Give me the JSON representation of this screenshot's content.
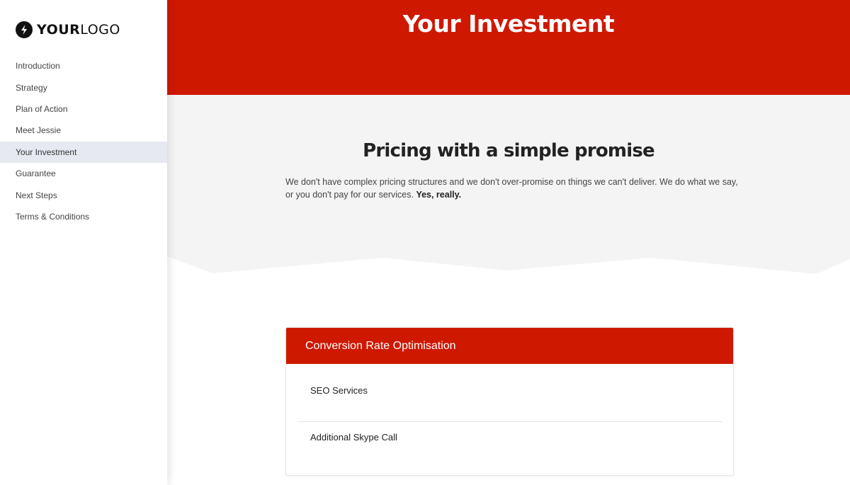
{
  "logo": {
    "icon": "lightning-bolt-icon",
    "text_bold": "YOUR",
    "text_light": "LOGO"
  },
  "sidebar": {
    "items": [
      {
        "label": "Introduction",
        "active": false
      },
      {
        "label": "Strategy",
        "active": false
      },
      {
        "label": "Plan of Action",
        "active": false
      },
      {
        "label": "Meet Jessie",
        "active": false
      },
      {
        "label": "Your Investment",
        "active": true
      },
      {
        "label": "Guarantee",
        "active": false
      },
      {
        "label": "Next Steps",
        "active": false
      },
      {
        "label": "Terms & Conditions",
        "active": false
      }
    ]
  },
  "hero": {
    "title": "Your Investment"
  },
  "intro": {
    "title": "Pricing with a simple promise",
    "text": "We don't have complex pricing structures and we don't over-promise on things we can't deliver. We do what we say, or you don't pay for our services.",
    "emphasis": "Yes, really."
  },
  "pricing_card": {
    "title": "Conversion Rate Optimisation",
    "items": [
      {
        "label": "SEO Services"
      },
      {
        "label": "Additional Skype Call"
      }
    ]
  },
  "colors": {
    "brand_red": "#cf1800",
    "section_gray": "#f4f4f4",
    "active_nav": "#e6e9ef"
  }
}
